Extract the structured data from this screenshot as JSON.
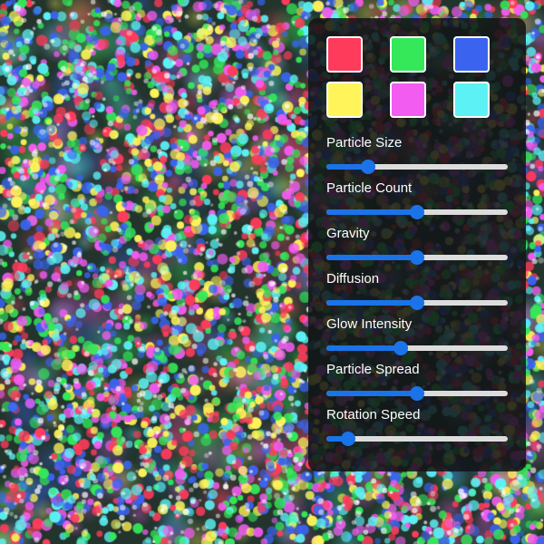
{
  "background": {
    "description_colors": [
      "#ff3b5c",
      "#34e85a",
      "#3a64f0",
      "#fff45a",
      "#f25cf0",
      "#5cf2f5"
    ]
  },
  "palette": {
    "swatches": [
      {
        "name": "red",
        "color": "#ff3b5c"
      },
      {
        "name": "green",
        "color": "#34e85a"
      },
      {
        "name": "blue",
        "color": "#3a64f0"
      },
      {
        "name": "yellow",
        "color": "#fff45a"
      },
      {
        "name": "magenta",
        "color": "#f25cf0"
      },
      {
        "name": "cyan",
        "color": "#5cf2f5"
      }
    ]
  },
  "controls": [
    {
      "key": "particle-size",
      "label": "Particle Size",
      "value": 0.23
    },
    {
      "key": "particle-count",
      "label": "Particle Count",
      "value": 0.5
    },
    {
      "key": "gravity",
      "label": "Gravity",
      "value": 0.5
    },
    {
      "key": "diffusion",
      "label": "Diffusion",
      "value": 0.5
    },
    {
      "key": "glow-intensity",
      "label": "Glow Intensity",
      "value": 0.41
    },
    {
      "key": "particle-spread",
      "label": "Particle Spread",
      "value": 0.5
    },
    {
      "key": "rotation-speed",
      "label": "Rotation Speed",
      "value": 0.12
    }
  ],
  "accent_color": "#1a73e8",
  "track_color": "#dcdcdc"
}
